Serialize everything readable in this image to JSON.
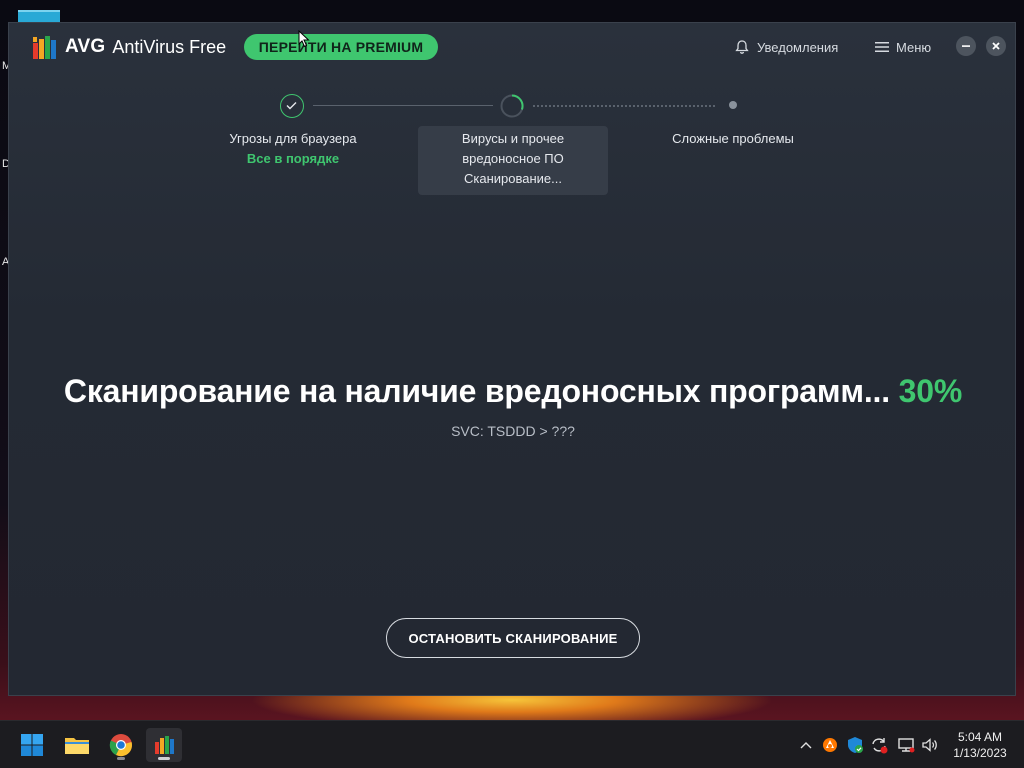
{
  "desktop": {
    "edge_letters": [
      "M",
      "D",
      "A"
    ]
  },
  "app": {
    "brand": "AVG",
    "product": "AntiVirus Free",
    "premium_label": "ПЕРЕЙТИ НА PREMIUM",
    "notifications_label": "Уведомления",
    "menu_label": "Меню"
  },
  "steps": [
    {
      "title_lines": [
        "Угрозы для браузера"
      ],
      "status": "Все в порядке",
      "state": "done"
    },
    {
      "title_lines": [
        "Вирусы и прочее",
        "вредоносное ПО"
      ],
      "status": "Сканирование...",
      "state": "active"
    },
    {
      "title_lines": [
        "Сложные проблемы"
      ],
      "status": "",
      "state": "pending"
    }
  ],
  "scan": {
    "headline": "Сканирование на наличие вредоносных программ...",
    "percent": "30%",
    "current_item": "SVC: TSDDD > ???",
    "stop_label": "ОСТАНОВИТЬ СКАНИРОВАНИЕ",
    "progress_fraction": 0.3
  },
  "taskbar": {
    "apps": [
      "start-icon",
      "file-explorer-icon",
      "chrome-icon",
      "avg-icon"
    ],
    "tray": [
      "chevron-up-icon",
      "avast-icon",
      "defender-icon",
      "sync-icon",
      "network-icon",
      "volume-icon"
    ],
    "time": "5:04 AM",
    "date": "1/13/2023"
  },
  "colors": {
    "accent_green": "#3fc66f",
    "window_bg": "#272d37",
    "text_primary": "#ffffff"
  }
}
